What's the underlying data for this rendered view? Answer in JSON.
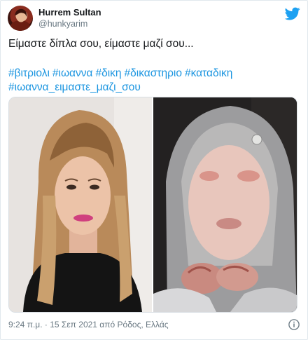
{
  "tweet": {
    "author": {
      "display_name": "Hurrem Sultan",
      "handle": "@hunkyarim"
    },
    "text": "Είμαστε δίπλα σου, είμαστε μαζί σου...",
    "hashtags": [
      "#βιτριολι",
      "#ιωαννα",
      "#δικη",
      "#δικαστηριο",
      "#καταδικη",
      "#ιωαννα_ειμαστε_μαζι_σου"
    ],
    "media": [
      {
        "alt_icon": "photo-woman-long-hair"
      },
      {
        "alt_icon": "photo-person-bandaged-face"
      }
    ],
    "timestamp": "9:24 π.μ. · 15 Σεπ 2021 από Ρόδος, Ελλάς"
  },
  "icons": {
    "brand": "twitter-bird-icon",
    "info": "info-icon"
  },
  "colors": {
    "link": "#1b95e0",
    "brand": "#1da1f2",
    "secondary_text": "#697882",
    "border": "#e1e8ed"
  }
}
